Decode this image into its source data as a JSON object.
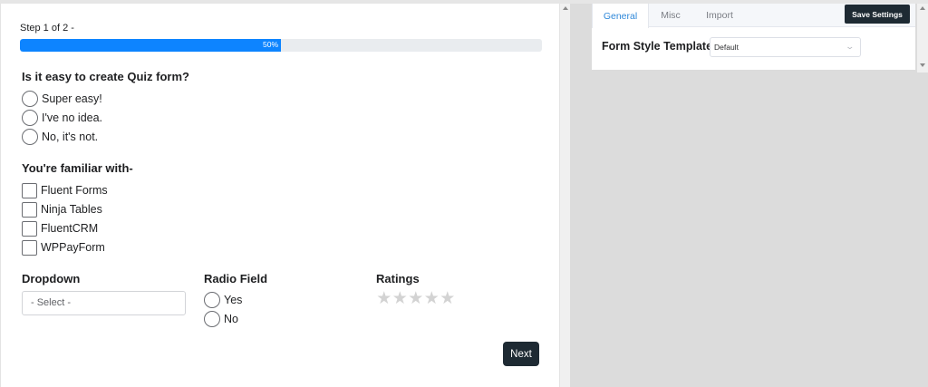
{
  "preview": {
    "step_text": "Step 1 of 2 -",
    "progress": {
      "value_percent": 50,
      "label": "50%"
    },
    "question1": {
      "label": "Is it easy to create Quiz form?",
      "options": [
        "Super easy!",
        "I've no idea.",
        "No, it's not."
      ]
    },
    "question2": {
      "label": "You're familiar with-",
      "options": [
        "Fluent Forms",
        "Ninja Tables",
        "FluentCRM",
        "WPPayForm"
      ]
    },
    "dropdown": {
      "label": "Dropdown",
      "placeholder": "- Select -"
    },
    "radio_field": {
      "label": "Radio Field",
      "options": [
        "Yes",
        "No"
      ]
    },
    "ratings": {
      "label": "Ratings",
      "star_count": 5,
      "filled": 0,
      "star_glyph": "★"
    },
    "next_label": "Next"
  },
  "settings": {
    "tabs": [
      {
        "label": "General",
        "active": true
      },
      {
        "label": "Misc",
        "active": false
      },
      {
        "label": "Import",
        "active": false
      }
    ],
    "save_label": "Save Settings",
    "form_style": {
      "label": "Form Style Template",
      "value": "Default",
      "chevron_icon": "chevron-down-icon"
    }
  },
  "colors": {
    "accent": "#0d84ff",
    "button_dark": "#1e2a33",
    "tab_active": "#2f88d9",
    "star_empty": "#d3d3d3",
    "canvas_bg": "#dcdcdc"
  }
}
